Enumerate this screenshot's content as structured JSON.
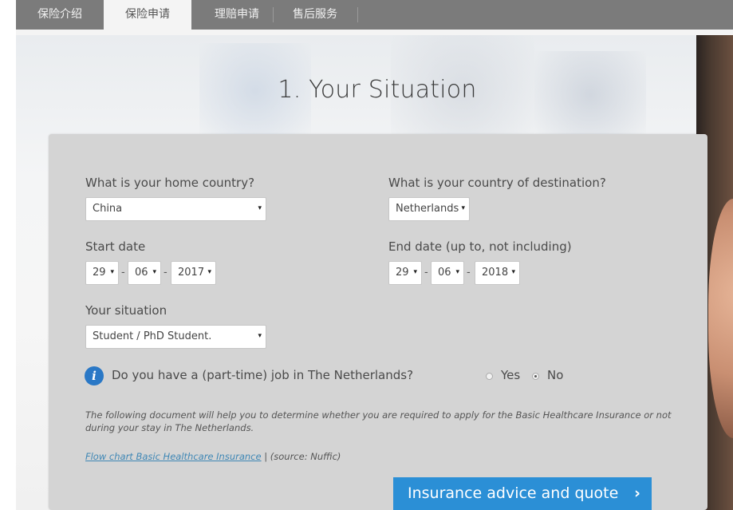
{
  "nav": {
    "tabs": [
      {
        "label": "保险介绍"
      },
      {
        "label": "保险申请"
      },
      {
        "label": "理赔申请"
      },
      {
        "label": "售后服务"
      }
    ]
  },
  "page": {
    "title": "1. Your Situation"
  },
  "form": {
    "home_country": {
      "label": "What is your home country?",
      "value": "China"
    },
    "destination": {
      "label": "What is your country of destination?",
      "value": "Netherlands"
    },
    "start_date": {
      "label": "Start date",
      "day": "29",
      "month": "06",
      "year": "2017"
    },
    "end_date": {
      "label": "End date (up to, not including)",
      "day": "29",
      "month": "06",
      "year": "2018"
    },
    "situation": {
      "label": "Your situation",
      "value": "Student / PhD Student."
    },
    "job_question": {
      "text": "Do you have a (part-time) job in The Netherlands?",
      "yes": "Yes",
      "no": "No",
      "selected": "No"
    },
    "separator": "-"
  },
  "info": {
    "note": "The following document will help you to determine whether you are required to apply for the Basic Healthcare Insurance or not during your stay in The Netherlands.",
    "link_text": "Flow chart Basic Healthcare Insurance",
    "source": " | (source: Nuffic)"
  },
  "cta": {
    "label": "Insurance advice and quote",
    "chevron": "›"
  },
  "icons": {
    "info": "i",
    "dropdown": "▾"
  },
  "colors": {
    "accent": "#2b8fd6",
    "info_icon": "#2a78c6",
    "link": "#3f87b5",
    "nav": "#7b7b7b"
  }
}
